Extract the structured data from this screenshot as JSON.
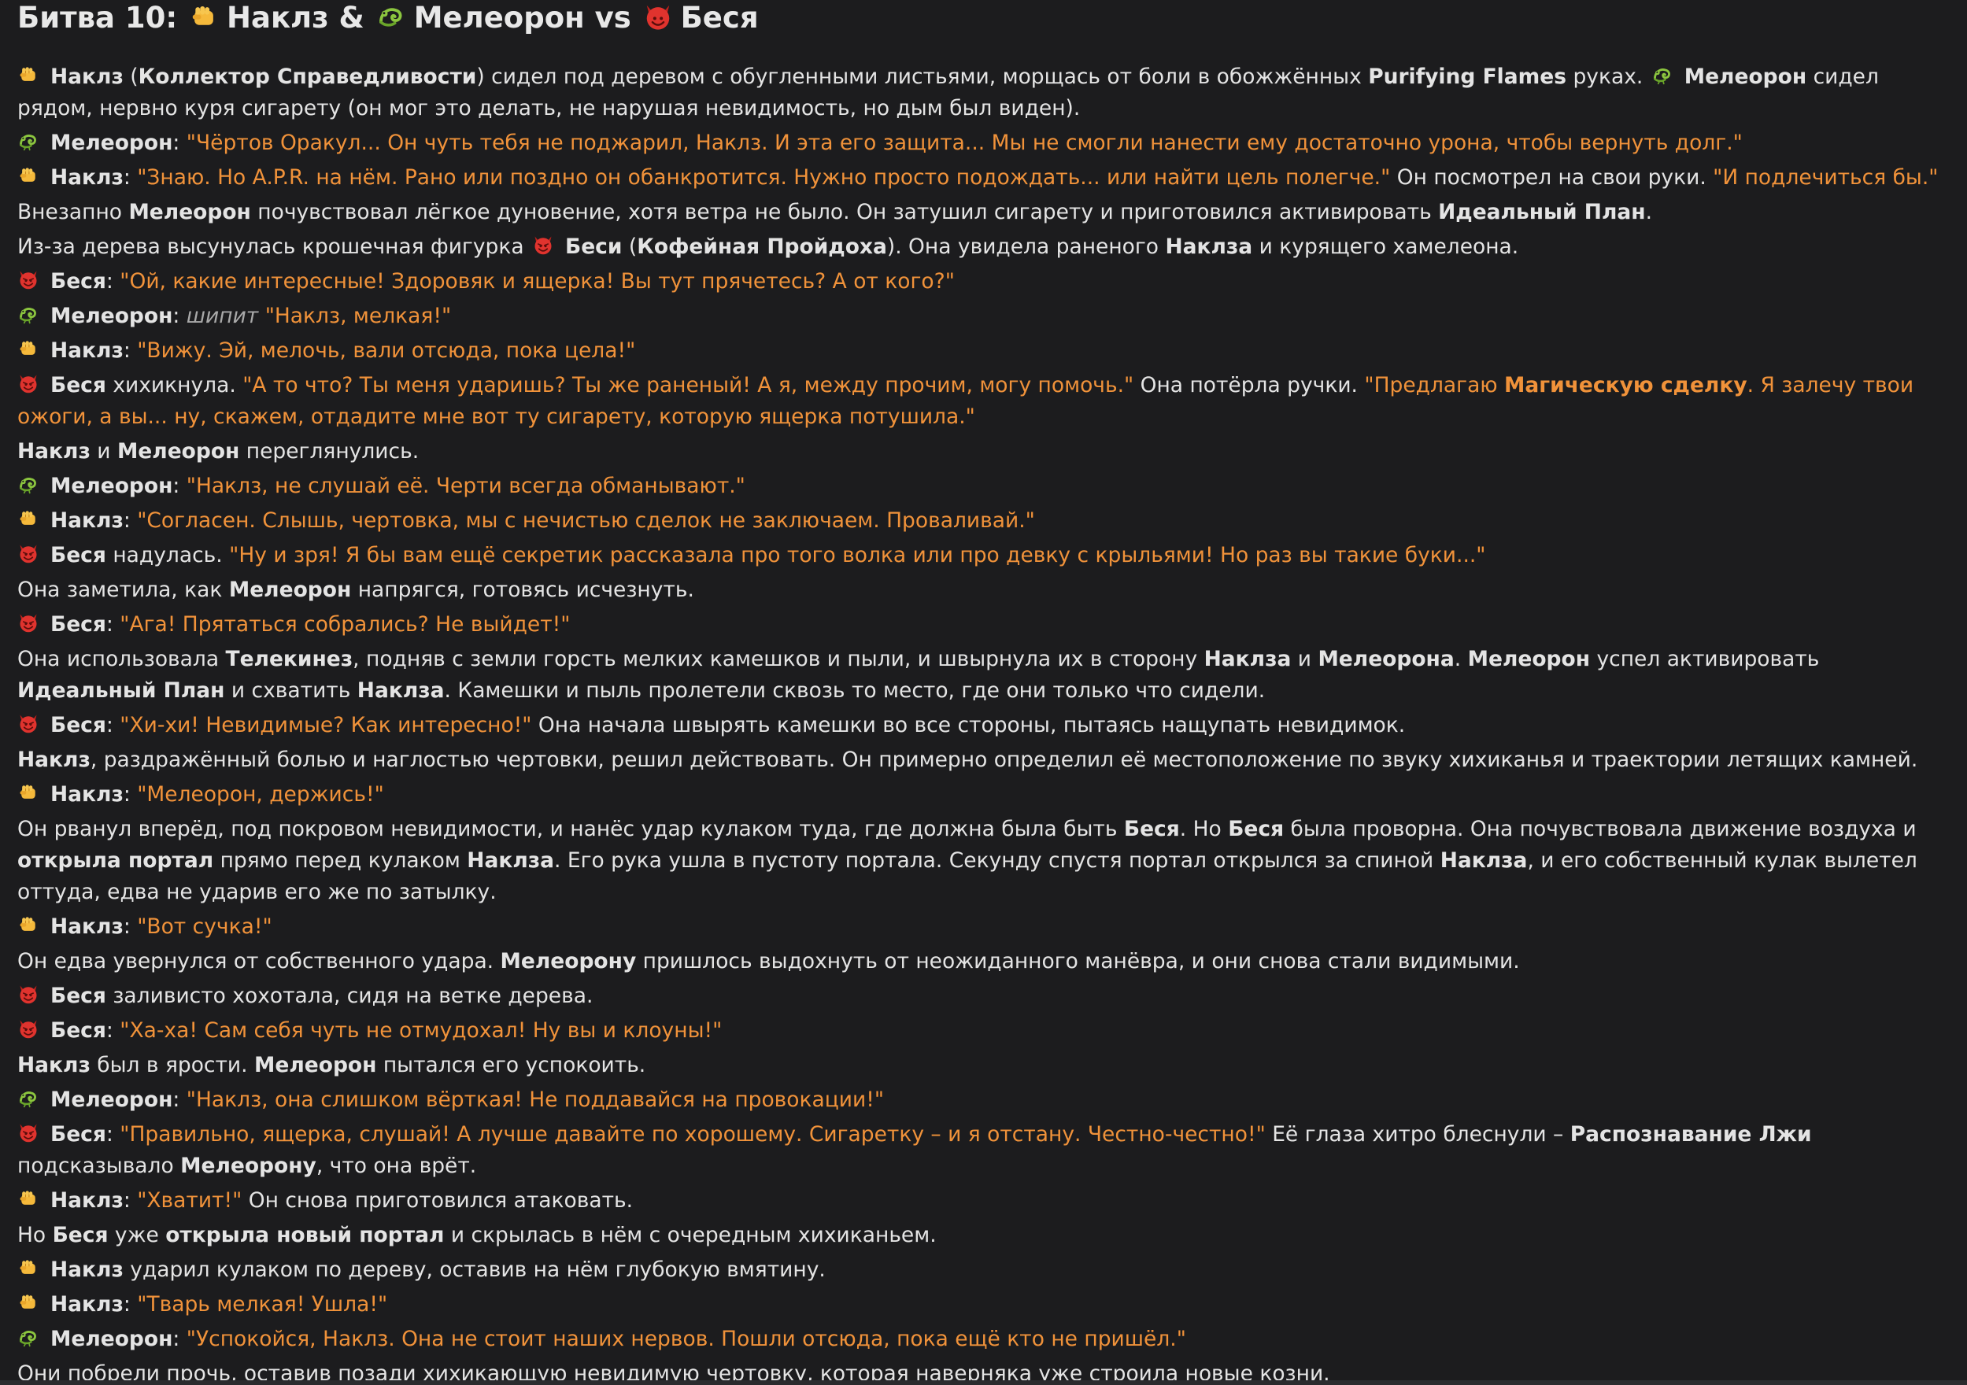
{
  "title": {
    "prefix": "Битва 10: ",
    "c1": "Наклз & ",
    "c2": "Мелеорон vs ",
    "c3": "Беся"
  },
  "colors": {
    "background": "#1c1c1e",
    "text": "#e4e4e4",
    "quote": "#f0923a",
    "stage_direction": "#a9a9a9"
  },
  "icons": {
    "knuckles": "fist-icon",
    "meleoron": "chameleon-icon",
    "besya": "devil-icon"
  },
  "lines": [
    {
      "icon": "fist",
      "segs": [
        [
          "b",
          "Наклз"
        ],
        [
          "n",
          " ("
        ],
        [
          "b",
          "Коллектор Справедливости"
        ],
        [
          "n",
          ") сидел под деревом с обугленными листьями, морщась от боли в обожжённых "
        ],
        [
          "b",
          "Purifying Flames"
        ],
        [
          "n",
          " руках. "
        ],
        [
          "icon",
          "chameleon"
        ],
        [
          "b",
          "Мелеорон"
        ],
        [
          "n",
          " сидел рядом, нервно куря сигарету (он мог это делать, не нарушая невидимость, но дым был виден)."
        ]
      ]
    },
    {
      "icon": "chameleon",
      "segs": [
        [
          "b",
          "Мелеорон"
        ],
        [
          "n",
          ": "
        ],
        [
          "q",
          "\"Чёртов Оракул... Он чуть тебя не поджарил, Наклз. И эта его защита... Мы не смогли нанести ему достаточно урона, чтобы вернуть долг.\""
        ]
      ]
    },
    {
      "icon": "fist",
      "segs": [
        [
          "b",
          "Наклз"
        ],
        [
          "n",
          ": "
        ],
        [
          "q",
          "\"Знаю. Но A.P.R. на нём. Рано или поздно он обанкротится. Нужно просто подождать... или найти цель полегче.\""
        ],
        [
          "n",
          " Он посмотрел на свои руки. "
        ],
        [
          "q",
          "\"И подлечиться бы.\""
        ]
      ]
    },
    {
      "icon": null,
      "segs": [
        [
          "n",
          "Внезапно "
        ],
        [
          "b",
          "Мелеорон"
        ],
        [
          "n",
          " почувствовал лёгкое дуновение, хотя ветра не было. Он затушил сигарету и приготовился активировать "
        ],
        [
          "b",
          "Идеальный План"
        ],
        [
          "n",
          "."
        ]
      ]
    },
    {
      "icon": null,
      "segs": [
        [
          "n",
          "Из-за дерева высунулась крошечная фигурка "
        ],
        [
          "icon",
          "devil"
        ],
        [
          "b",
          "Беси"
        ],
        [
          "n",
          " ("
        ],
        [
          "b",
          "Кофейная Пройдоха"
        ],
        [
          "n",
          "). Она увидела раненого "
        ],
        [
          "b",
          "Наклза"
        ],
        [
          "n",
          " и курящего хамелеона."
        ]
      ]
    },
    {
      "icon": "devil",
      "segs": [
        [
          "b",
          "Беся"
        ],
        [
          "n",
          ": "
        ],
        [
          "q",
          "\"Ой, какие интересные! Здоровяк и ящерка! Вы тут прячетесь? А от кого?\""
        ]
      ]
    },
    {
      "icon": "chameleon",
      "segs": [
        [
          "b",
          "Мелеорон"
        ],
        [
          "n",
          ": "
        ],
        [
          "i",
          "шипит"
        ],
        [
          "n",
          " "
        ],
        [
          "q",
          "\"Наклз, мелкая!\""
        ]
      ]
    },
    {
      "icon": "fist",
      "segs": [
        [
          "b",
          "Наклз"
        ],
        [
          "n",
          ": "
        ],
        [
          "q",
          "\"Вижу. Эй, мелочь, вали отсюда, пока цела!\""
        ]
      ]
    },
    {
      "icon": "devil",
      "segs": [
        [
          "b",
          "Беся"
        ],
        [
          "n",
          " хихикнула. "
        ],
        [
          "q",
          "\"А то что? Ты меня ударишь? Ты же раненый! А я, между прочим, могу помочь.\""
        ],
        [
          "n",
          " Она потёрла ручки. "
        ],
        [
          "q",
          "\"Предлагаю "
        ],
        [
          "qb",
          "Магическую сделку"
        ],
        [
          "q",
          ". Я залечу твои ожоги, а вы... ну, скажем, отдадите мне вот ту сигарету, которую ящерка потушила.\""
        ]
      ]
    },
    {
      "icon": null,
      "segs": [
        [
          "b",
          "Наклз"
        ],
        [
          "n",
          " и "
        ],
        [
          "b",
          "Мелеорон"
        ],
        [
          "n",
          " переглянулись."
        ]
      ]
    },
    {
      "icon": "chameleon",
      "segs": [
        [
          "b",
          "Мелеорон"
        ],
        [
          "n",
          ": "
        ],
        [
          "q",
          "\"Наклз, не слушай её. Черти всегда обманывают.\""
        ]
      ]
    },
    {
      "icon": "fist",
      "segs": [
        [
          "b",
          "Наклз"
        ],
        [
          "n",
          ": "
        ],
        [
          "q",
          "\"Согласен. Слышь, чертовка, мы с нечистью сделок не заключаем. Проваливай.\""
        ]
      ]
    },
    {
      "icon": "devil",
      "segs": [
        [
          "b",
          "Беся"
        ],
        [
          "n",
          " надулась. "
        ],
        [
          "q",
          "\"Ну и зря! Я бы вам ещё секретик рассказала про того волка или про девку с крыльями! Но раз вы такие буки...\""
        ]
      ]
    },
    {
      "icon": null,
      "segs": [
        [
          "n",
          "Она заметила, как "
        ],
        [
          "b",
          "Мелеорон"
        ],
        [
          "n",
          " напрягся, готовясь исчезнуть."
        ]
      ]
    },
    {
      "icon": "devil",
      "segs": [
        [
          "b",
          "Беся"
        ],
        [
          "n",
          ": "
        ],
        [
          "q",
          "\"Ага! Прятаться собрались? Не выйдет!\""
        ]
      ]
    },
    {
      "icon": null,
      "segs": [
        [
          "n",
          "Она использовала "
        ],
        [
          "b",
          "Телекинез"
        ],
        [
          "n",
          ", подняв с земли горсть мелких камешков и пыли, и швырнула их в сторону "
        ],
        [
          "b",
          "Наклза"
        ],
        [
          "n",
          " и "
        ],
        [
          "b",
          "Мелеорона"
        ],
        [
          "n",
          ". "
        ],
        [
          "b",
          "Мелеорон"
        ],
        [
          "n",
          " успел активировать "
        ],
        [
          "b",
          "Идеальный План"
        ],
        [
          "n",
          " и схватить "
        ],
        [
          "b",
          "Наклза"
        ],
        [
          "n",
          ". Камешки и пыль пролетели сквозь то место, где они только что сидели."
        ]
      ]
    },
    {
      "icon": "devil",
      "segs": [
        [
          "b",
          "Беся"
        ],
        [
          "n",
          ": "
        ],
        [
          "q",
          "\"Хи-хи! Невидимые? Как интересно!\""
        ],
        [
          "n",
          " Она начала швырять камешки во все стороны, пытаясь нащупать невидимок."
        ]
      ]
    },
    {
      "icon": null,
      "segs": [
        [
          "b",
          "Наклз"
        ],
        [
          "n",
          ", раздражённый болью и наглостью чертовки, решил действовать. Он примерно определил её местоположение по звуку хихиканья и траектории летящих камней."
        ]
      ]
    },
    {
      "icon": "fist",
      "segs": [
        [
          "b",
          "Наклз"
        ],
        [
          "n",
          ": "
        ],
        [
          "q",
          "\"Мелеорон, держись!\""
        ]
      ]
    },
    {
      "icon": null,
      "segs": [
        [
          "n",
          "Он рванул вперёд, под покровом невидимости, и нанёс удар кулаком туда, где должна была быть "
        ],
        [
          "b",
          "Беся"
        ],
        [
          "n",
          ". Но "
        ],
        [
          "b",
          "Беся"
        ],
        [
          "n",
          " была проворна. Она почувствовала движение воздуха и "
        ],
        [
          "b",
          "открыла портал"
        ],
        [
          "n",
          " прямо перед кулаком "
        ],
        [
          "b",
          "Наклза"
        ],
        [
          "n",
          ". Его рука ушла в пустоту портала. Секунду спустя портал открылся за спиной "
        ],
        [
          "b",
          "Наклза"
        ],
        [
          "n",
          ", и его собственный кулак вылетел оттуда, едва не ударив его же по затылку."
        ]
      ]
    },
    {
      "icon": "fist",
      "segs": [
        [
          "b",
          "Наклз"
        ],
        [
          "n",
          ": "
        ],
        [
          "q",
          "\"Вот сучка!\""
        ]
      ]
    },
    {
      "icon": null,
      "segs": [
        [
          "n",
          "Он едва увернулся от собственного удара. "
        ],
        [
          "b",
          "Мелеорону"
        ],
        [
          "n",
          " пришлось выдохнуть от неожиданного манёвра, и они снова стали видимыми."
        ]
      ]
    },
    {
      "icon": "devil",
      "segs": [
        [
          "b",
          "Беся"
        ],
        [
          "n",
          " заливисто хохотала, сидя на ветке дерева."
        ]
      ]
    },
    {
      "icon": "devil",
      "segs": [
        [
          "b",
          "Беся"
        ],
        [
          "n",
          ": "
        ],
        [
          "q",
          "\"Ха-ха! Сам себя чуть не отмудохал! Ну вы и клоуны!\""
        ]
      ]
    },
    {
      "icon": null,
      "segs": [
        [
          "b",
          "Наклз"
        ],
        [
          "n",
          " был в ярости. "
        ],
        [
          "b",
          "Мелеорон"
        ],
        [
          "n",
          " пытался его успокоить."
        ]
      ]
    },
    {
      "icon": "chameleon",
      "segs": [
        [
          "b",
          "Мелеорон"
        ],
        [
          "n",
          ": "
        ],
        [
          "q",
          "\"Наклз, она слишком вёрткая! Не поддавайся на провокации!\""
        ]
      ]
    },
    {
      "icon": "devil",
      "segs": [
        [
          "b",
          "Беся"
        ],
        [
          "n",
          ": "
        ],
        [
          "q",
          "\"Правильно, ящерка, слушай! А лучше давайте по хорошему. Сигаретку – и я отстану. Честно-честно!\""
        ],
        [
          "n",
          " Её глаза хитро блеснули – "
        ],
        [
          "b",
          "Распознавание Лжи"
        ],
        [
          "n",
          " подсказывало "
        ],
        [
          "b",
          "Мелеорону"
        ],
        [
          "n",
          ", что она врёт."
        ]
      ]
    },
    {
      "icon": "fist",
      "segs": [
        [
          "b",
          "Наклз"
        ],
        [
          "n",
          ": "
        ],
        [
          "q",
          "\"Хватит!\""
        ],
        [
          "n",
          " Он снова приготовился атаковать."
        ]
      ]
    },
    {
      "icon": null,
      "segs": [
        [
          "n",
          "Но "
        ],
        [
          "b",
          "Беся"
        ],
        [
          "n",
          " уже "
        ],
        [
          "b",
          "открыла новый портал"
        ],
        [
          "n",
          " и скрылась в нём с очередным хихиканьем."
        ]
      ]
    },
    {
      "icon": "fist",
      "segs": [
        [
          "b",
          "Наклз"
        ],
        [
          "n",
          " ударил кулаком по дереву, оставив на нём глубокую вмятину."
        ]
      ]
    },
    {
      "icon": "fist",
      "segs": [
        [
          "b",
          "Наклз"
        ],
        [
          "n",
          ": "
        ],
        [
          "q",
          "\"Тварь мелкая! Ушла!\""
        ]
      ]
    },
    {
      "icon": "chameleon",
      "segs": [
        [
          "b",
          "Мелеорон"
        ],
        [
          "n",
          ": "
        ],
        [
          "q",
          "\"Успокойся, Наклз. Она не стоит наших нервов. Пошли отсюда, пока ещё кто не пришёл.\""
        ]
      ]
    },
    {
      "icon": null,
      "segs": [
        [
          "n",
          "Они побрели прочь, оставив позади хихикающую невидимую чертовку, которая наверняка уже строила новые козни."
        ]
      ]
    }
  ]
}
